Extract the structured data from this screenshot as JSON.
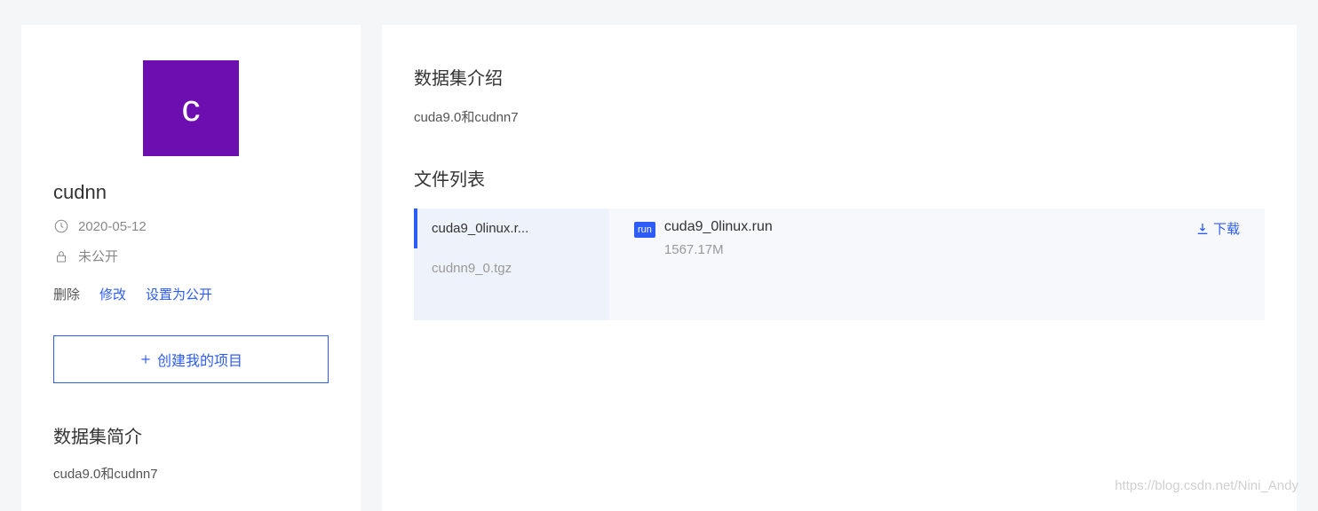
{
  "sidebar": {
    "avatar_letter": "c",
    "title": "cudnn",
    "date": "2020-05-12",
    "visibility": "未公开",
    "actions": {
      "delete": "删除",
      "edit": "修改",
      "set_public": "设置为公开"
    },
    "create_button": "创建我的项目",
    "intro_heading": "数据集简介",
    "intro_text": "cuda9.0和cudnn7"
  },
  "main": {
    "intro_heading": "数据集介绍",
    "intro_text": "cuda9.0和cudnn7",
    "files_heading": "文件列表",
    "file_tabs": [
      {
        "label": "cuda9_0linux.r..."
      },
      {
        "label": "cudnn9_0.tgz"
      }
    ],
    "selected_file": {
      "badge": "run",
      "name": "cuda9_0linux.run",
      "size": "1567.17M"
    },
    "download_label": "下载"
  },
  "watermark": "https://blog.csdn.net/Nini_Andy"
}
